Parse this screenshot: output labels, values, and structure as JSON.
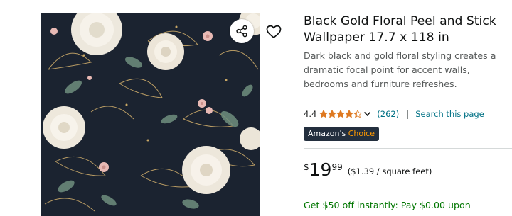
{
  "product": {
    "title": "Black Gold Floral Peel and Stick Wallpaper 17.7 x 118 in",
    "description": "Dark black and gold floral styling creates a dramatic focal point for accent walls, bedrooms and furniture refreshes.",
    "image_subject": "dark navy floral wallpaper with white roses, pink blossoms and gold line leaves"
  },
  "actions": {
    "share_icon": "share-icon",
    "favorite_icon": "heart-icon"
  },
  "rating": {
    "value": "4.4",
    "stars": 4.4,
    "max_stars": 5,
    "review_count": "(262)",
    "search_link": "Search this page"
  },
  "badge": {
    "prefix": "Amazon's",
    "suffix": "Choice"
  },
  "price": {
    "symbol": "$",
    "whole": "19",
    "fraction": "99",
    "unit_price": "($1.39 / square feet)"
  },
  "promo": {
    "text": "Get $50 off instantly: Pay $0.00 upon"
  },
  "colors": {
    "link": "#007185",
    "star": "#de7921",
    "badge_bg": "#232f3e",
    "badge_accent": "#ff9900",
    "promo": "#007600",
    "image_bg": "#1b2330"
  }
}
